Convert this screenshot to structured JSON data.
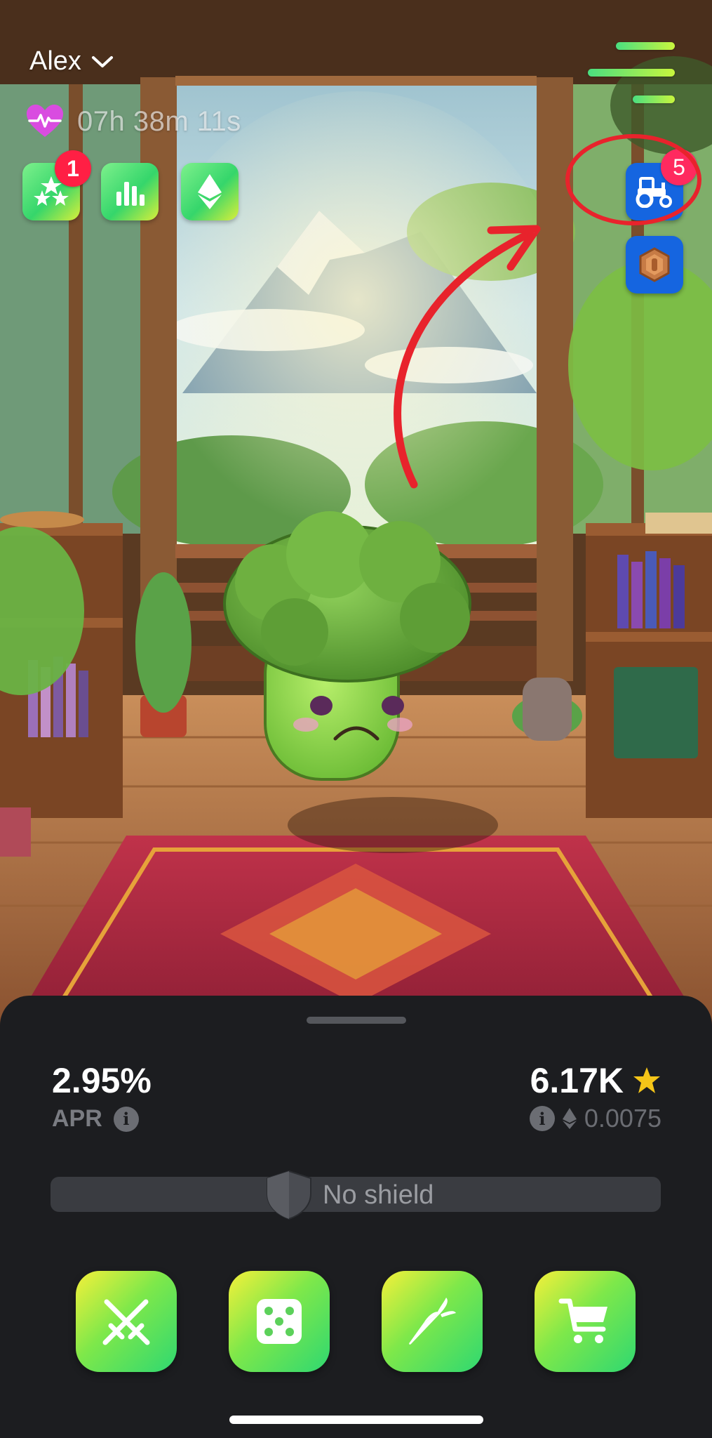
{
  "header": {
    "user_name": "Alex",
    "timer": "07h 38m 11s"
  },
  "top_buttons": {
    "quests_badge": "1",
    "farm_badge": "5"
  },
  "icons": {
    "user_dropdown": "chevron-down-icon",
    "health": "heart-pulse-icon",
    "menu": "menu-icon",
    "quests": "stars-icon",
    "leaderboard": "bar-chart-icon",
    "ethereum": "ethereum-icon",
    "farm": "tractor-icon",
    "token": "bronze-coin-icon",
    "info": "info-icon",
    "star": "star-icon",
    "shield": "shield-icon",
    "battle": "crossed-swords-icon",
    "dice": "dice-icon",
    "feed": "carrot-icon",
    "shop": "shopping-cart-icon"
  },
  "stats": {
    "apr_value": "2.95%",
    "apr_label": "APR",
    "stars_value": "6.17K",
    "eth_value": "0.0075"
  },
  "shield": {
    "label": "No shield"
  },
  "colors": {
    "badge_red": "#ff1f44",
    "button_blue": "#1565e0",
    "star_gold": "#f5c518",
    "annotation_red": "#e8232c",
    "panel_bg": "#1c1d20"
  }
}
